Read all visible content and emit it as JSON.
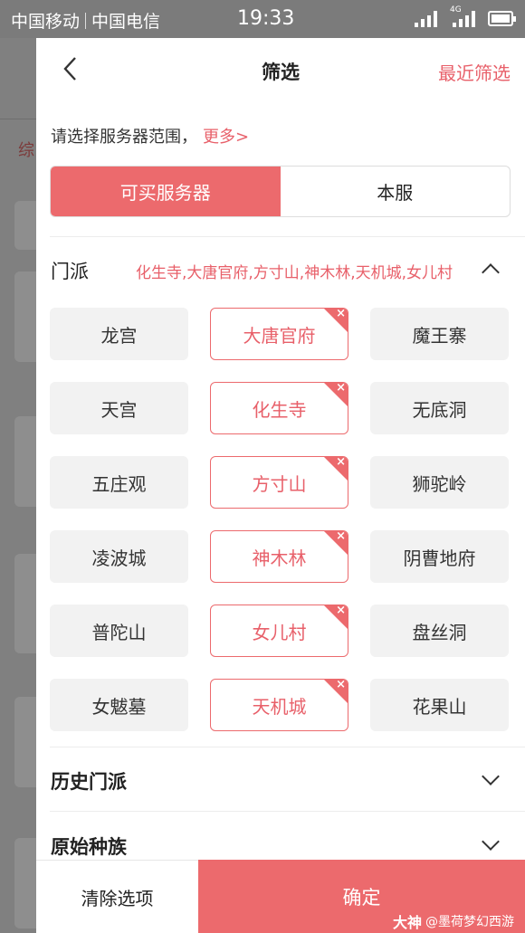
{
  "status_bar": {
    "carrier1": "中国移动",
    "carrier2": "中国电信",
    "time": "19:33",
    "network": "4G"
  },
  "background": {
    "tab_char": "综"
  },
  "nav": {
    "title": "筛选",
    "recent": "最近筛选",
    "back_icon": "chevron-left-icon"
  },
  "server": {
    "hint": "请选择服务器范围，",
    "more": "更多>",
    "options": [
      "可买服务器",
      "本服"
    ],
    "active_index": 0
  },
  "school": {
    "label": "门派",
    "selected_summary": "化生寺,大唐官府,方寸山,神木林,天机城,女儿村",
    "expanded": true,
    "chips": [
      {
        "label": "龙宫",
        "selected": false
      },
      {
        "label": "大唐官府",
        "selected": true
      },
      {
        "label": "魔王寨",
        "selected": false
      },
      {
        "label": "天宫",
        "selected": false
      },
      {
        "label": "化生寺",
        "selected": true
      },
      {
        "label": "无底洞",
        "selected": false
      },
      {
        "label": "五庄观",
        "selected": false
      },
      {
        "label": "方寸山",
        "selected": true
      },
      {
        "label": "狮驼岭",
        "selected": false
      },
      {
        "label": "凌波城",
        "selected": false
      },
      {
        "label": "神木林",
        "selected": true
      },
      {
        "label": "阴曹地府",
        "selected": false
      },
      {
        "label": "普陀山",
        "selected": false
      },
      {
        "label": "女儿村",
        "selected": true
      },
      {
        "label": "盘丝洞",
        "selected": false
      },
      {
        "label": "女魃墓",
        "selected": false
      },
      {
        "label": "天机城",
        "selected": true
      },
      {
        "label": "花果山",
        "selected": false
      }
    ],
    "remove_glyph": "×"
  },
  "history_school": {
    "label": "历史门派"
  },
  "origin_race": {
    "label": "原始种族"
  },
  "footer": {
    "clear": "清除选项",
    "confirm": "确定"
  },
  "watermark": {
    "logo": "大神",
    "text": "@墨荷梦幻西游"
  },
  "colors": {
    "accent": "#ec6a6d",
    "chip_bg": "#f2f2f2"
  }
}
